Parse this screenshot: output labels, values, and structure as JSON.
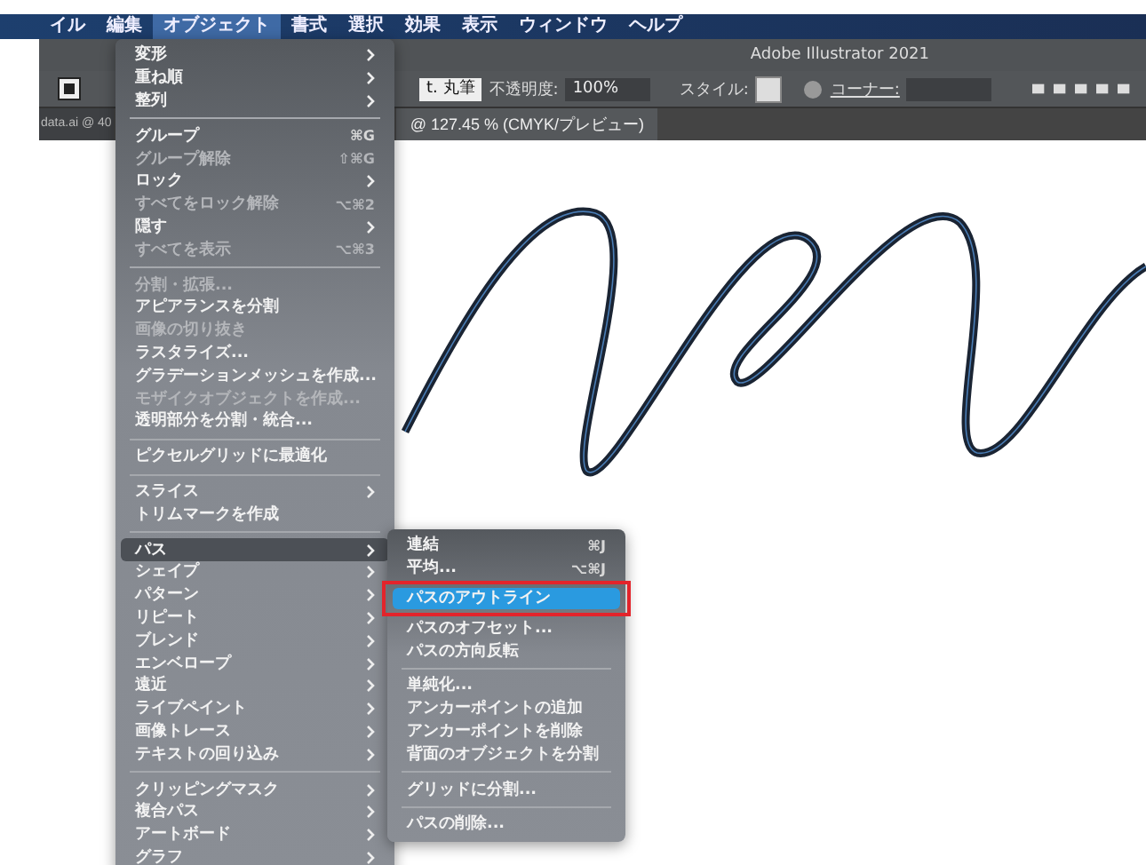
{
  "menubar": [
    {
      "label": "イル",
      "selected": false
    },
    {
      "label": "編集",
      "selected": false
    },
    {
      "label": "オブジェクト",
      "selected": true
    },
    {
      "label": "書式",
      "selected": false
    },
    {
      "label": "選択",
      "selected": false
    },
    {
      "label": "効果",
      "selected": false
    },
    {
      "label": "表示",
      "selected": false
    },
    {
      "label": "ウィンドウ",
      "selected": false
    },
    {
      "label": "ヘルプ",
      "selected": false
    }
  ],
  "window": {
    "title": "Adobe Illustrator 2021"
  },
  "toolbar": {
    "brush": "t. 丸筆",
    "opacity_label": "不透明度:",
    "opacity": "100%",
    "style_label": "スタイル:",
    "corner_label": "コーナー:"
  },
  "tabs": [
    {
      "label": "data.ai @ 40",
      "selected": false
    },
    {
      "label": "@ 127.45 % (CMYK/プレビュー)",
      "selected": true
    }
  ],
  "menu": [
    {
      "kind": "item",
      "label": "変形",
      "submenu": true,
      "disabled": false,
      "selected": false
    },
    {
      "kind": "item",
      "label": "重ね順",
      "submenu": true,
      "disabled": false,
      "selected": false
    },
    {
      "kind": "item",
      "label": "整列",
      "submenu": true,
      "disabled": false,
      "selected": false
    },
    {
      "kind": "separator"
    },
    {
      "kind": "item",
      "label": "グループ",
      "shortcut": "⌘G",
      "submenu": false,
      "disabled": false,
      "selected": false
    },
    {
      "kind": "item",
      "label": "グループ解除",
      "shortcut": "⇧⌘G",
      "submenu": false,
      "disabled": true,
      "selected": false
    },
    {
      "kind": "item",
      "label": "ロック",
      "submenu": true,
      "disabled": false,
      "selected": false
    },
    {
      "kind": "item",
      "label": "すべてをロック解除",
      "shortcut": "⌥⌘2",
      "submenu": false,
      "disabled": true,
      "selected": false
    },
    {
      "kind": "item",
      "label": "隠す",
      "submenu": true,
      "disabled": false,
      "selected": false
    },
    {
      "kind": "item",
      "label": "すべてを表示",
      "shortcut": "⌥⌘3",
      "submenu": false,
      "disabled": true,
      "selected": false
    },
    {
      "kind": "separator"
    },
    {
      "kind": "item",
      "label": "分割・拡張...",
      "submenu": false,
      "disabled": true,
      "selected": false
    },
    {
      "kind": "item",
      "label": "アピアランスを分割",
      "submenu": false,
      "disabled": false,
      "selected": false
    },
    {
      "kind": "item",
      "label": "画像の切り抜き",
      "submenu": false,
      "disabled": true,
      "selected": false
    },
    {
      "kind": "item",
      "label": "ラスタライズ...",
      "submenu": false,
      "disabled": false,
      "selected": false
    },
    {
      "kind": "item",
      "label": "グラデーションメッシュを作成...",
      "submenu": false,
      "disabled": false,
      "selected": false
    },
    {
      "kind": "item",
      "label": "モザイクオブジェクトを作成...",
      "submenu": false,
      "disabled": true,
      "selected": false
    },
    {
      "kind": "item",
      "label": "透明部分を分割・統合...",
      "submenu": false,
      "disabled": false,
      "selected": false
    },
    {
      "kind": "separator"
    },
    {
      "kind": "item",
      "label": "ピクセルグリッドに最適化",
      "submenu": false,
      "disabled": false,
      "selected": false
    },
    {
      "kind": "separator"
    },
    {
      "kind": "item",
      "label": "スライス",
      "submenu": true,
      "disabled": false,
      "selected": false
    },
    {
      "kind": "item",
      "label": "トリムマークを作成",
      "submenu": false,
      "disabled": false,
      "selected": false
    },
    {
      "kind": "separator"
    },
    {
      "kind": "item",
      "label": "パス",
      "submenu": true,
      "disabled": false,
      "selected": true
    },
    {
      "kind": "item",
      "label": "シェイプ",
      "submenu": true,
      "disabled": false,
      "selected": false
    },
    {
      "kind": "item",
      "label": "パターン",
      "submenu": true,
      "disabled": false,
      "selected": false
    },
    {
      "kind": "item",
      "label": "リピート",
      "submenu": true,
      "disabled": false,
      "selected": false
    },
    {
      "kind": "item",
      "label": "ブレンド",
      "submenu": true,
      "disabled": false,
      "selected": false
    },
    {
      "kind": "item",
      "label": "エンベロープ",
      "submenu": true,
      "disabled": false,
      "selected": false
    },
    {
      "kind": "item",
      "label": "遠近",
      "submenu": true,
      "disabled": false,
      "selected": false
    },
    {
      "kind": "item",
      "label": "ライブペイント",
      "submenu": true,
      "disabled": false,
      "selected": false
    },
    {
      "kind": "item",
      "label": "画像トレース",
      "submenu": true,
      "disabled": false,
      "selected": false
    },
    {
      "kind": "item",
      "label": "テキストの回り込み",
      "submenu": true,
      "disabled": false,
      "selected": false
    },
    {
      "kind": "separator"
    },
    {
      "kind": "item",
      "label": "クリッピングマスク",
      "submenu": true,
      "disabled": false,
      "selected": false
    },
    {
      "kind": "item",
      "label": "複合パス",
      "submenu": true,
      "disabled": false,
      "selected": false
    },
    {
      "kind": "item",
      "label": "アートボード",
      "submenu": true,
      "disabled": false,
      "selected": false
    },
    {
      "kind": "item",
      "label": "グラフ",
      "submenu": true,
      "disabled": false,
      "selected": false
    }
  ],
  "submenu": [
    {
      "kind": "item",
      "label": "連結",
      "shortcut": "⌘J",
      "disabled": false,
      "selected": false
    },
    {
      "kind": "item",
      "label": "平均...",
      "shortcut": "⌥⌘J",
      "disabled": false,
      "selected": false
    },
    {
      "kind": "item",
      "label": "パスのアウトライン",
      "disabled": false,
      "selected": true,
      "outlined": true
    },
    {
      "kind": "item",
      "label": "パスのオフセット...",
      "disabled": false,
      "selected": false
    },
    {
      "kind": "item",
      "label": "パスの方向反転",
      "disabled": false,
      "selected": false
    },
    {
      "kind": "separator"
    },
    {
      "kind": "item",
      "label": "単純化...",
      "disabled": false,
      "selected": false
    },
    {
      "kind": "item",
      "label": "アンカーポイントの追加",
      "disabled": false,
      "selected": false
    },
    {
      "kind": "item",
      "label": "アンカーポイントを削除",
      "disabled": false,
      "selected": false
    },
    {
      "kind": "item",
      "label": "背面のオブジェクトを分割",
      "disabled": false,
      "selected": false
    },
    {
      "kind": "separator"
    },
    {
      "kind": "item",
      "label": "グリッドに分割...",
      "disabled": false,
      "selected": false
    },
    {
      "kind": "separator"
    },
    {
      "kind": "item",
      "label": "パスの削除...",
      "disabled": false,
      "selected": false
    }
  ]
}
